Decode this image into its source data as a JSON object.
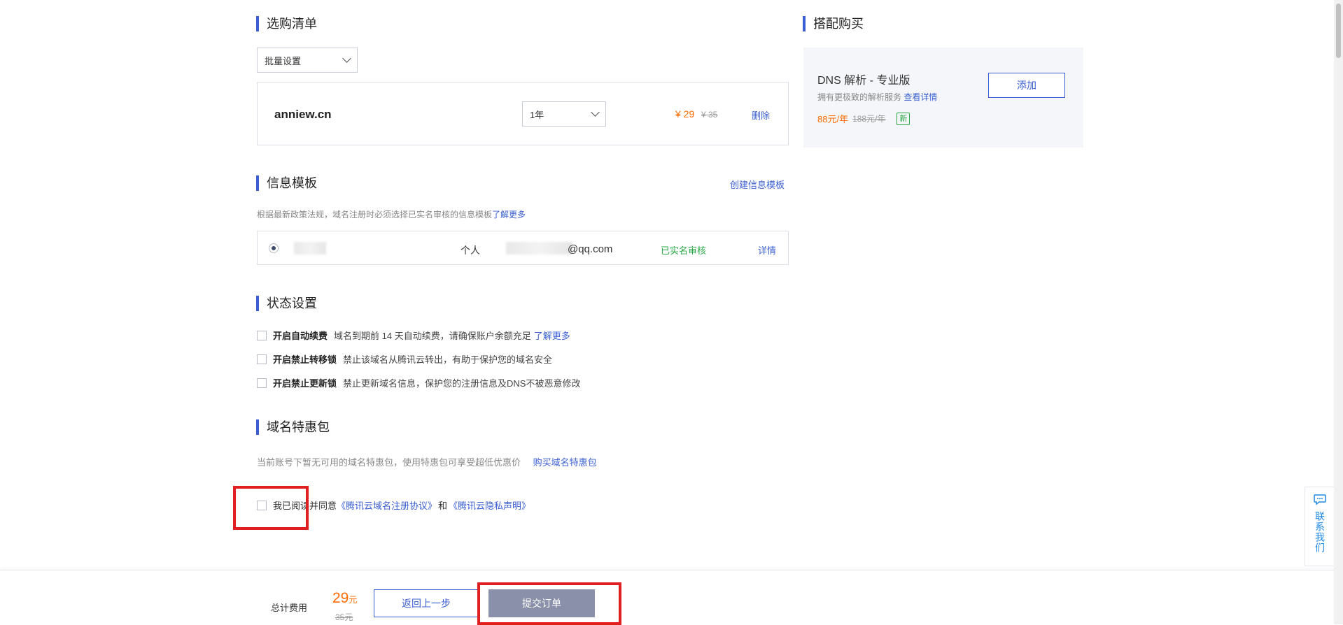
{
  "cart": {
    "title": "选购清单",
    "bulk_select": "批量设置",
    "item": {
      "domain": "anniew.cn",
      "period": "1年",
      "price": "¥ 29",
      "orig_price": "¥ 35",
      "delete": "删除"
    }
  },
  "addon": {
    "title": "搭配购买",
    "name": "DNS 解析 - 专业版",
    "desc": "拥有更极致的解析服务",
    "detail_link": "查看详情",
    "price": "88元/年",
    "orig_price": "188元/年",
    "badge": "新",
    "add_button": "添加"
  },
  "template": {
    "title": "信息模板",
    "create_link": "创建信息模板",
    "notice": "根据最新政策法规，域名注册时必须选择已实名审核的信息模板",
    "notice_link": "了解更多",
    "row": {
      "type": "个人",
      "email_suffix": "@qq.com",
      "status": "已实名审核",
      "details": "详情"
    }
  },
  "status": {
    "title": "状态设置",
    "options": [
      {
        "label": "开启自动续费",
        "desc": "域名到期前 14 天自动续费，请确保账户余额充足",
        "link": "了解更多"
      },
      {
        "label": "开启禁止转移锁",
        "desc": "禁止该域名从腾讯云转出，有助于保护您的域名安全"
      },
      {
        "label": "开启禁止更新锁",
        "desc": "禁止更新域名信息，保护您的注册信息及DNS不被恶意修改"
      }
    ]
  },
  "package": {
    "title": "域名特惠包",
    "desc": "当前账号下暂无可用的域名特惠包，使用特惠包可享受超低优惠价",
    "buy_link": "购买域名特惠包"
  },
  "agreement": {
    "prefix": "我已阅读并同意",
    "link1": "《腾讯云域名注册协议》",
    "and": "和",
    "link2": "《腾讯云隐私声明》"
  },
  "footer": {
    "total_label": "总计费用",
    "total": "29",
    "unit": "元",
    "orig": "35元",
    "back_button": "返回上一步",
    "submit_button": "提交订单"
  },
  "contact": {
    "label": "联系我们"
  },
  "colors": {
    "accent": "#3b5fd1",
    "price": "#ff6a00",
    "verified": "#29a745",
    "submit_bg": "#8a90aa",
    "highlight": "#e02020"
  }
}
